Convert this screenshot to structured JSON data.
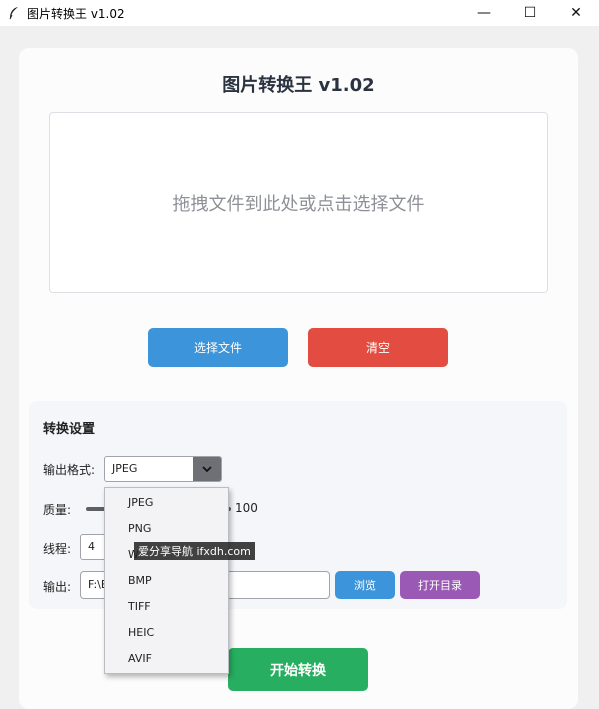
{
  "window": {
    "title": "图片转换王 v1.02",
    "controls": {
      "minimize": "—",
      "maximize": "☐",
      "close": "✕"
    }
  },
  "app": {
    "heading": "图片转换王 v1.02",
    "dropzone_text": "拖拽文件到此处或点击选择文件",
    "select_file_button": "选择文件",
    "clear_button": "清空",
    "start_button": "开始转换"
  },
  "settings": {
    "heading": "转换设置",
    "format_label": "输出格式:",
    "format_value": "JPEG",
    "quality_label": "质量:",
    "quality_value": "100",
    "threads_label": "线程:",
    "threads_value": "4",
    "output_label": "输出:",
    "output_value": "F:\\E",
    "browse_button": "浏览",
    "open_dir_button": "打开目录"
  },
  "format_dropdown": {
    "options": [
      "JPEG",
      "PNG",
      "W",
      "BMP",
      "TIFF",
      "HEIC",
      "AVIF"
    ]
  },
  "watermark": "爱分享导航 ifxdh.com",
  "colors": {
    "blue": "#3c95db",
    "red": "#e34c40",
    "purple": "#9b59b6",
    "green": "#27ae60"
  },
  "icons": {
    "app": "feather-icon",
    "dropdown_arrow": "chevron-down-icon"
  }
}
